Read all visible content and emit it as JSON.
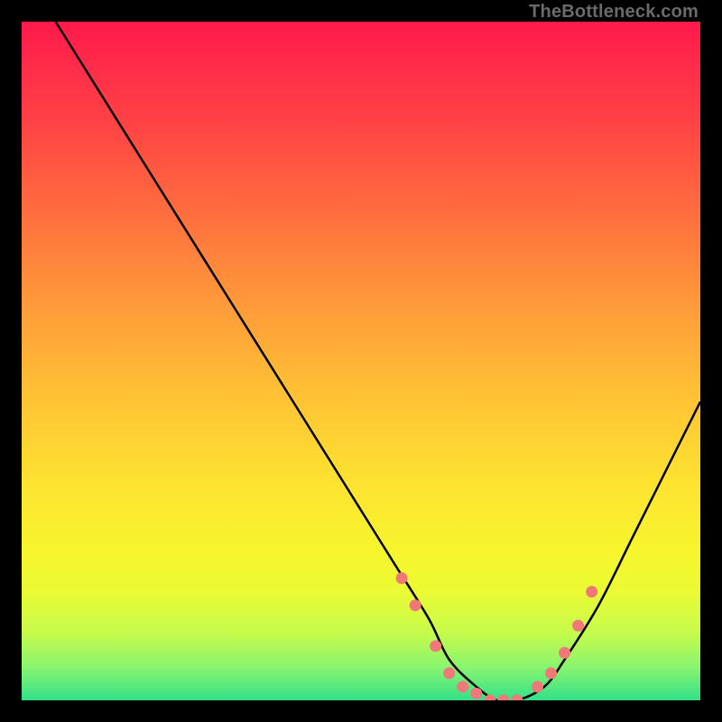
{
  "watermark": "TheBottleneck.com",
  "chart_data": {
    "type": "line",
    "title": "",
    "xlabel": "",
    "ylabel": "",
    "xlim": [
      0,
      100
    ],
    "ylim": [
      0,
      100
    ],
    "grid": false,
    "legend": false,
    "gradient_colors": [
      "#ff1a4b",
      "#ff4345",
      "#ff953a",
      "#ffc235",
      "#fee330",
      "#ebfb34",
      "#8af56e",
      "#33e08a"
    ],
    "series": [
      {
        "name": "bottleneck-curve",
        "color": "#000000",
        "x": [
          5,
          10,
          15,
          20,
          25,
          30,
          35,
          40,
          45,
          50,
          55,
          60,
          63,
          67,
          70,
          73,
          77,
          80,
          85,
          90,
          95,
          100
        ],
        "y": [
          100,
          92,
          84,
          76,
          68,
          60,
          52,
          44,
          36,
          28,
          20,
          12,
          6,
          2,
          0,
          0,
          2,
          6,
          14,
          24,
          34,
          44
        ]
      },
      {
        "name": "valley-markers",
        "color": "#f07878",
        "marker": "dot",
        "x": [
          56,
          58,
          61,
          63,
          65,
          67,
          69,
          71,
          73,
          76,
          78,
          80,
          82,
          84
        ],
        "y": [
          18,
          14,
          8,
          4,
          2,
          1,
          0,
          0,
          0,
          2,
          4,
          7,
          11,
          16
        ]
      }
    ]
  }
}
